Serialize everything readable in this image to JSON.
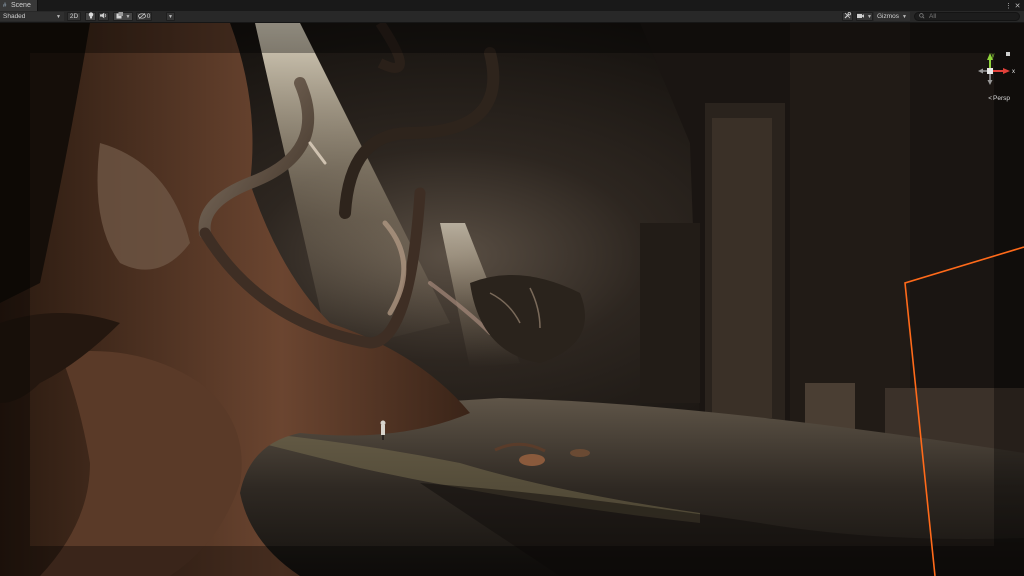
{
  "window": {
    "tab_label": "Scene",
    "tab_icon": "scene-hash-icon",
    "controls": [
      "more-icon",
      "close-icon"
    ]
  },
  "toolbar": {
    "shading_mode": "Shaded",
    "view_2d_label": "2D",
    "audio_icon": "speaker-icon",
    "lighting_icon": "lightbulb-icon",
    "effects_icon": "effects-icon",
    "hidden_count": "0",
    "tools_icon": "wrench-icon",
    "camera_icon": "camera-icon",
    "gizmos_label": "Gizmos",
    "search_placeholder": "All"
  },
  "scene": {
    "gizmo_axes": {
      "y": "y",
      "x": "x"
    },
    "projection_label": "Persp",
    "colors": {
      "selection_outline": "#ff6a1a",
      "gizmo_y": "#8fd43a",
      "gizmo_x": "#e0403a",
      "gizmo_z": "#4a7fdc"
    }
  }
}
